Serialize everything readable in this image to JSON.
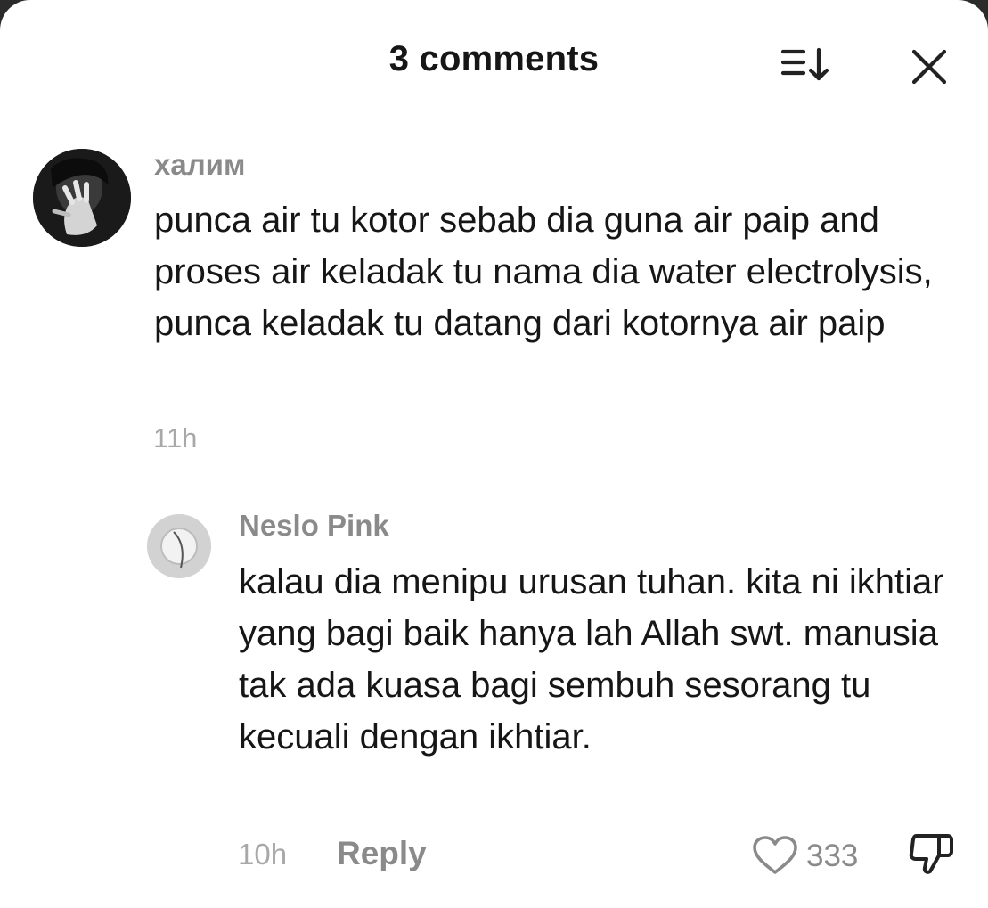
{
  "header": {
    "title": "3 comments",
    "sort_icon": "sort-icon",
    "close_icon": "close-icon"
  },
  "comments": [
    {
      "username": "халим",
      "text": "punca air tu kotor sebab dia guna air paip and proses air keladak tu nama dia water electrolysis, punca keladak tu datang dari kotornya air paip",
      "time": "11h",
      "avatar": "avatar-photo"
    },
    {
      "username": "Neslo Pink",
      "text": "kalau dia menipu urusan tuhan. kita ni ikhtiar yang bagi baik hanya lah Allah swt. manusia tak ada kuasa bagi sembuh sesorang tu kecuali dengan ikhtiar.",
      "time": "10h",
      "reply_label": "Reply",
      "like_count": "333",
      "avatar": "avatar-photo",
      "like_icon": "heart-icon",
      "dislike_icon": "thumbs-down-icon"
    }
  ],
  "colors": {
    "text": "#161616",
    "secondary": "#8a8a8a",
    "muted": "#a8a8a8",
    "background": "#ffffff"
  }
}
